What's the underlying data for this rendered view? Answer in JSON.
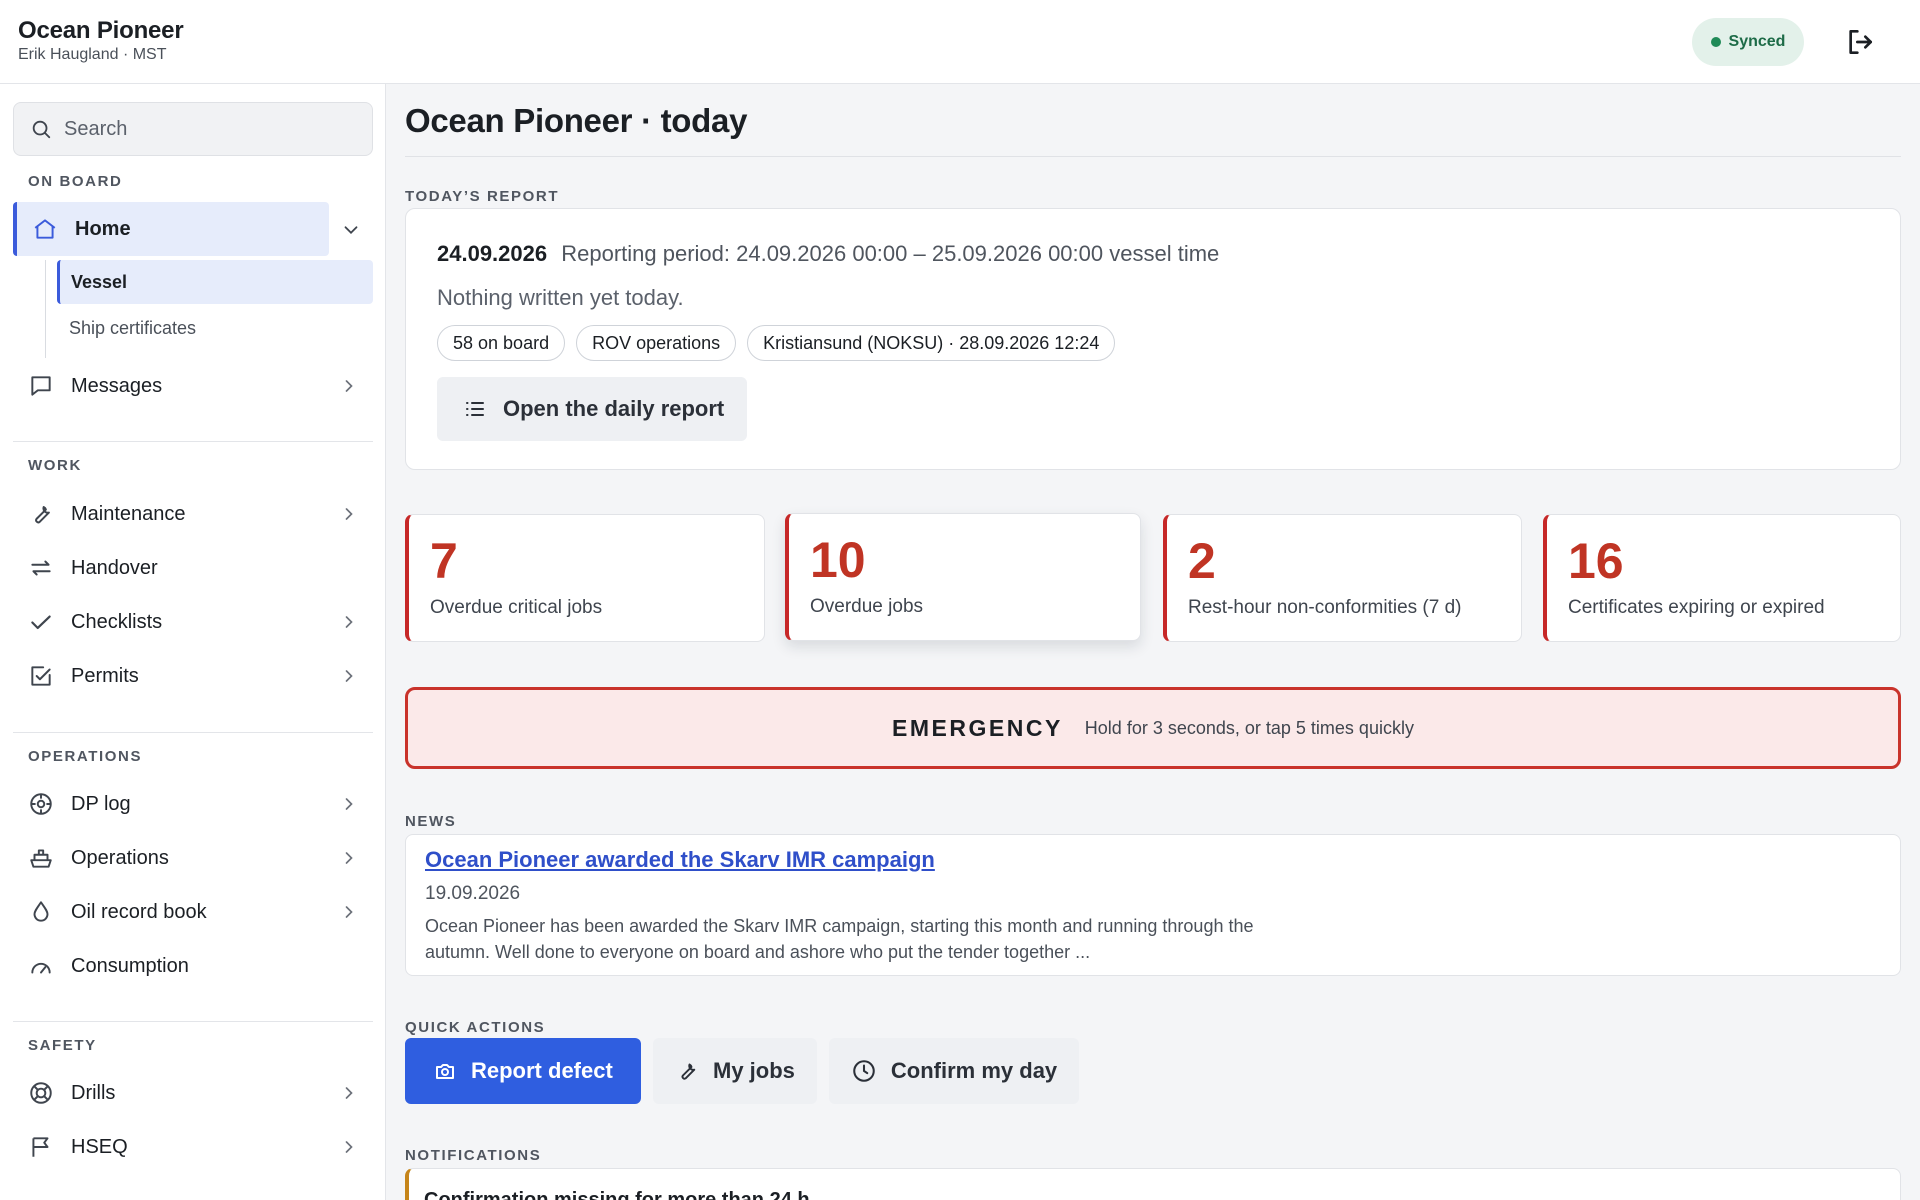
{
  "header": {
    "title": "Ocean Pioneer",
    "user_line": "Erik Haugland · MST",
    "sync_status": "Synced",
    "sync_color": "#1f8a57",
    "logout_icon": "logout-icon"
  },
  "search": {
    "placeholder": "Search",
    "value": ""
  },
  "sidebar": {
    "sections": {
      "on_board": "ON BOARD",
      "work": "WORK",
      "operations": "OPERATIONS",
      "safety": "SAFETY"
    },
    "home": {
      "label": "Home",
      "icon": "home-icon",
      "expanded": true
    },
    "home_children": [
      "Vessel",
      "Ship certificates"
    ],
    "messages": "Messages",
    "maintenance": "Maintenance",
    "handover": "Handover",
    "checklists": "Checklists",
    "permits": "Permits",
    "dp_log": "DP log",
    "operations_item": "Operations",
    "oil_record_book": "Oil record book",
    "consumption": "Consumption",
    "drills": "Drills",
    "hseq": "HSEQ"
  },
  "main": {
    "title": "Ocean Pioneer · today",
    "todays_report_label": "TODAY’S REPORT",
    "report": {
      "date": "24.09.2026",
      "period": "Reporting period: 24.09.2026 00:00 – 25.09.2026 00:00 vessel time",
      "empty_text": "Nothing written yet today.",
      "chips": [
        "58 on board",
        "ROV operations",
        "Kristiansund (NOKSU) · 28.09.2026 12:24"
      ],
      "open_button": "Open the daily report"
    },
    "stats": [
      {
        "value": "7",
        "label": "Overdue critical jobs"
      },
      {
        "value": "10",
        "label": "Overdue jobs"
      },
      {
        "value": "2",
        "label": "Rest-hour non-conformities (7 d)"
      },
      {
        "value": "16",
        "label": "Certificates expiring or expired"
      }
    ],
    "emergency": {
      "title": "EMERGENCY",
      "hint": "Hold for 3 seconds, or tap 5 times quickly",
      "accent": "#c9332b"
    },
    "news_label": "NEWS",
    "news": {
      "title": "Ocean Pioneer awarded the Skarv IMR campaign",
      "date": "19.09.2026",
      "body": "Ocean Pioneer has been awarded the Skarv IMR campaign, starting this month and running through the autumn. Well done to everyone on board and ashore who put the tender together ..."
    },
    "quick_actions_label": "QUICK ACTIONS",
    "quick_actions": {
      "report_defect": "Report defect",
      "my_jobs": "My jobs",
      "confirm_day": "Confirm my day"
    },
    "notifications_label": "NOTIFICATIONS",
    "notification": {
      "title": "Confirmation missing for more than 24 h"
    }
  },
  "colors": {
    "accent": "#3b5bdb",
    "primary_button": "#2f5ee0",
    "critical": "#c03424",
    "warning": "#c6851a"
  }
}
